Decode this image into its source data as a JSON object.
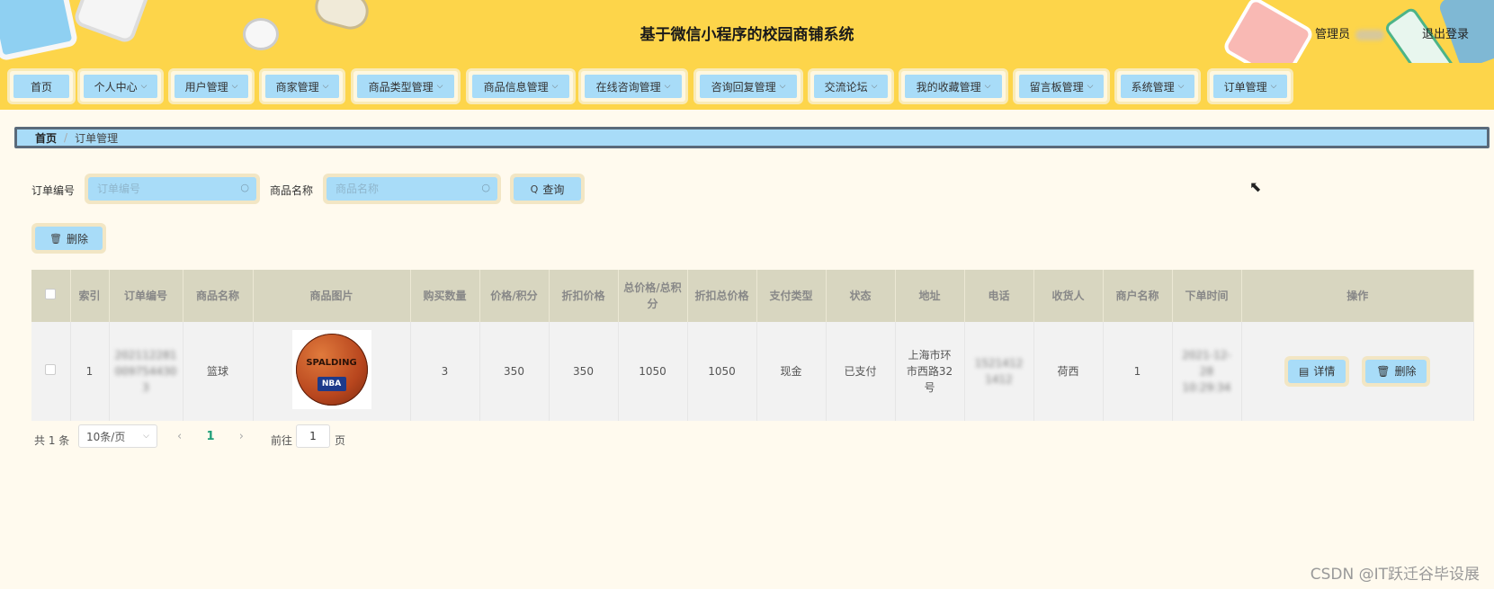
{
  "header": {
    "title": "基于微信小程序的校园商铺系统",
    "admin_label": "管理员",
    "logout_label": "退出登录"
  },
  "nav": {
    "items": [
      {
        "label": "首页",
        "dropdown": false
      },
      {
        "label": "个人中心",
        "dropdown": true
      },
      {
        "label": "用户管理",
        "dropdown": true
      },
      {
        "label": "商家管理",
        "dropdown": true
      },
      {
        "label": "商品类型管理",
        "dropdown": true
      },
      {
        "label": "商品信息管理",
        "dropdown": true
      },
      {
        "label": "在线咨询管理",
        "dropdown": true
      },
      {
        "label": "咨询回复管理",
        "dropdown": true
      },
      {
        "label": "交流论坛",
        "dropdown": true
      },
      {
        "label": "我的收藏管理",
        "dropdown": true
      },
      {
        "label": "留言板管理",
        "dropdown": true
      },
      {
        "label": "系统管理",
        "dropdown": true
      },
      {
        "label": "订单管理",
        "dropdown": true
      }
    ]
  },
  "breadcrumb": {
    "home": "首页",
    "separator": "/",
    "current": "订单管理"
  },
  "search": {
    "order_no_label": "订单编号",
    "order_no_placeholder": "订单编号",
    "product_name_label": "商品名称",
    "product_name_placeholder": "商品名称",
    "query_label": "查询"
  },
  "actions": {
    "delete_label": "删除"
  },
  "table": {
    "headers": [
      "索引",
      "订单编号",
      "商品名称",
      "商品图片",
      "购买数量",
      "价格/积分",
      "折扣价格",
      "总价格/总积分",
      "折扣总价格",
      "支付类型",
      "状态",
      "地址",
      "电话",
      "收货人",
      "商户名称",
      "下单时间",
      "操作"
    ],
    "rows": [
      {
        "index": "1",
        "order_no": "2021122810097544303",
        "product_name": "篮球",
        "image_text_top": "SPALDING",
        "image_text_badge": "NBA",
        "quantity": "3",
        "price": "350",
        "discount_price": "350",
        "total": "1050",
        "discount_total": "1050",
        "pay_type": "现金",
        "status": "已支付",
        "address": "上海市环市西路32号",
        "phone": "15214121412",
        "receiver": "荷西",
        "merchant": "1",
        "order_time": "2021-12-28 10:29:34",
        "detail_label": "详情",
        "delete_label": "删除"
      }
    ]
  },
  "pagination": {
    "total_text": "共 1 条",
    "page_size": "10条/页",
    "current_page": "1",
    "goto_label": "前往",
    "goto_value": "1",
    "page_suffix": "页"
  },
  "watermark": "CSDN @IT跃迁谷毕设展"
}
